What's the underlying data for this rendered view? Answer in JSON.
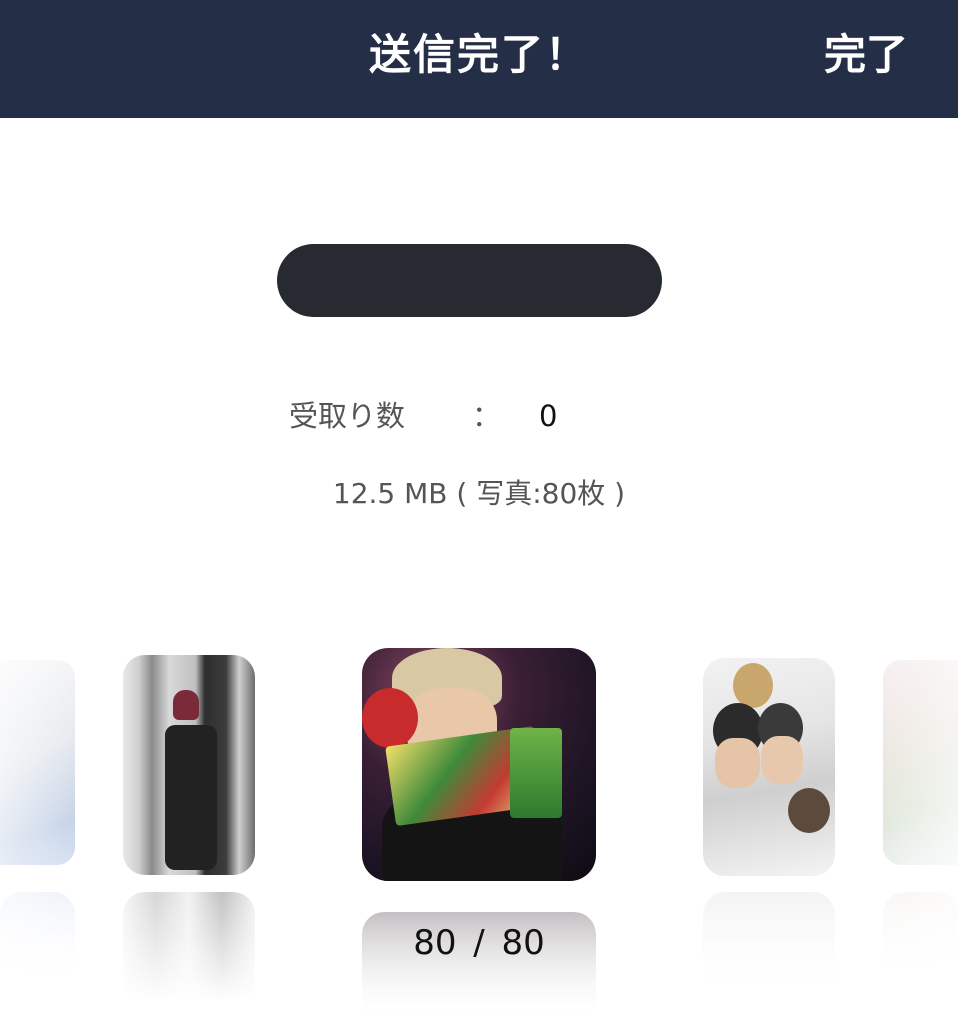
{
  "header": {
    "title": "送信完了！",
    "done_label": "完了"
  },
  "stats": {
    "received_label": "受取り数",
    "received_colon": "：",
    "received_value": "0",
    "size_info": "12.5 MB ( 写真:80枚 )"
  },
  "carousel": {
    "counter": "80  /  80",
    "photos": [
      "photo-1",
      "photo-2",
      "photo-3",
      "photo-4",
      "photo-5"
    ]
  },
  "colors": {
    "header_bg": "#252e47",
    "pill_bg": "#272b31",
    "background": "#ffffff"
  }
}
